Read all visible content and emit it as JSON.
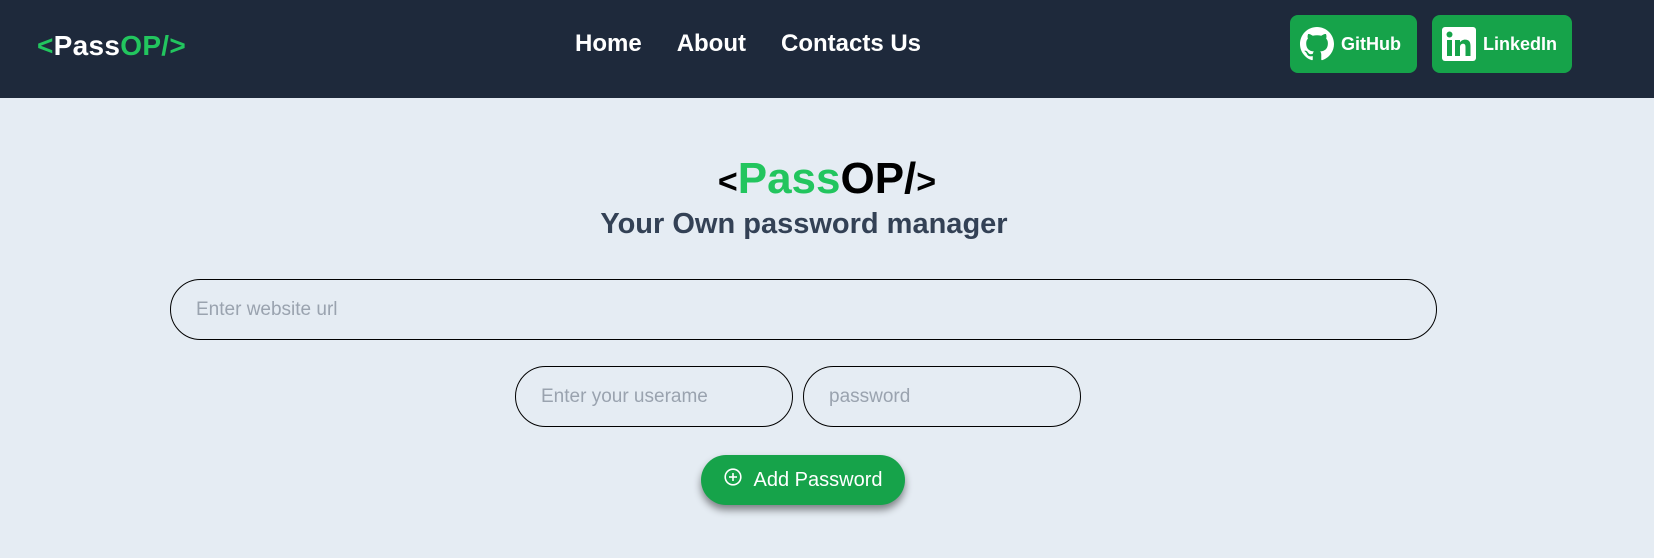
{
  "nav": {
    "logo": {
      "open": "<",
      "pass": "Pass",
      "op": "OP/",
      "close": ">"
    },
    "links": [
      {
        "label": "Home"
      },
      {
        "label": "About"
      },
      {
        "label": "Contacts Us"
      }
    ],
    "github": {
      "label": "GitHub",
      "icon": "github-icon"
    },
    "linkedin": {
      "label": "LinkedIn",
      "icon": "linkedin-icon"
    }
  },
  "hero": {
    "logo": {
      "open": "<",
      "pass": "Pass",
      "op": "OP/",
      "close": ">"
    },
    "subtitle": "Your Own password manager"
  },
  "form": {
    "url_placeholder": "Enter website url",
    "username_placeholder": "Enter your userame",
    "password_placeholder": "password",
    "add_button_label": "Add Password",
    "add_button_icon": "plus-circle-icon"
  },
  "colors": {
    "nav_bg": "#1e293b",
    "page_bg": "#e5ecf3",
    "accent_green": "#22c55e",
    "button_green": "#16a34a"
  }
}
